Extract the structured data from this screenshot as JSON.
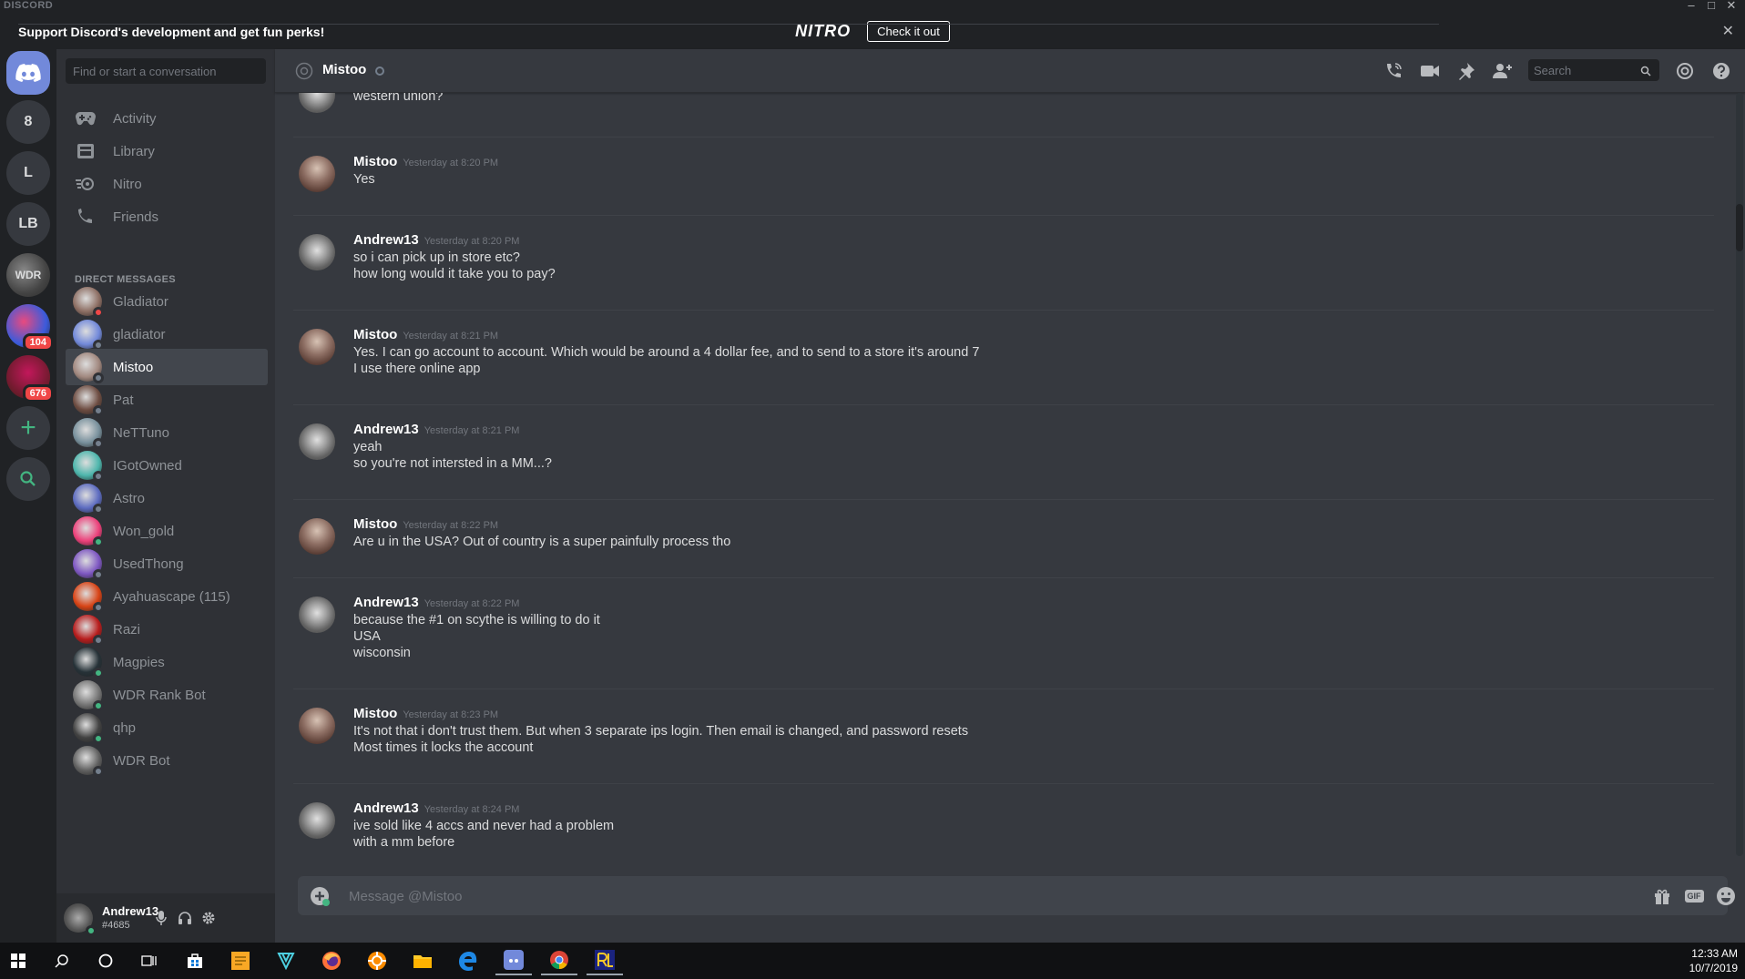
{
  "titlebar": {
    "brand": "DISCORD"
  },
  "banner": {
    "logo": "NITRO",
    "message": "Support Discord's development and get fun perks!",
    "cta": "Check it out"
  },
  "guilds": [
    {
      "label": "8"
    },
    {
      "label": "L"
    },
    {
      "label": "LB"
    },
    {
      "label": "WDR"
    },
    {
      "label": "",
      "badge": "104"
    },
    {
      "label": "",
      "badge": "676"
    }
  ],
  "sidebar": {
    "search_placeholder": "Find or start a conversation",
    "nav": [
      {
        "label": "Activity",
        "icon": "gamepad-icon"
      },
      {
        "label": "Library",
        "icon": "library-icon"
      },
      {
        "label": "Nitro",
        "icon": "nitro-icon"
      },
      {
        "label": "Friends",
        "icon": "friends-icon"
      }
    ],
    "dm_header": "DIRECT MESSAGES",
    "dms": [
      {
        "name": "Gladiator",
        "status": "dnd",
        "color": "#8d6e63"
      },
      {
        "name": "gladiator",
        "status": "offline",
        "color": "#7289da"
      },
      {
        "name": "Mistoo",
        "status": "offline",
        "color": "#a1887f",
        "active": true
      },
      {
        "name": "Pat",
        "status": "offline",
        "color": "#6d4c41"
      },
      {
        "name": "NeTTuno",
        "status": "offline",
        "color": "#78909c"
      },
      {
        "name": "IGotOwned",
        "status": "offline",
        "color": "#4db6ac"
      },
      {
        "name": "Astro",
        "status": "offline",
        "color": "#5c6bc0"
      },
      {
        "name": "Won_gold",
        "status": "online",
        "color": "#ec407a"
      },
      {
        "name": "UsedThong",
        "status": "offline",
        "color": "#7e57c2"
      },
      {
        "name": "Ayahuascape (115)",
        "status": "offline",
        "color": "#d84315"
      },
      {
        "name": "Razi",
        "status": "offline",
        "color": "#b71c1c"
      },
      {
        "name": "Magpies",
        "status": "online",
        "color": "#263238"
      },
      {
        "name": "WDR Rank Bot",
        "status": "online",
        "color": "#757575"
      },
      {
        "name": "qhp",
        "status": "online",
        "color": "#424242"
      },
      {
        "name": "WDR Bot",
        "status": "offline",
        "color": "#616161"
      }
    ]
  },
  "user": {
    "name": "Andrew13",
    "tag": "#4685"
  },
  "header": {
    "channel": "Mistoo",
    "search_placeholder": "Search"
  },
  "messages": [
    {
      "author": "",
      "time": "",
      "lines": [
        "western union?"
      ],
      "kind": "andrew"
    },
    {
      "author": "Mistoo",
      "time": "Yesterday at 8:20 PM",
      "lines": [
        "Yes"
      ],
      "kind": "mistoo"
    },
    {
      "author": "Andrew13",
      "time": "Yesterday at 8:20 PM",
      "lines": [
        "so i can pick up in store etc?",
        "how long would it take you to pay?"
      ],
      "kind": "andrew"
    },
    {
      "author": "Mistoo",
      "time": "Yesterday at 8:21 PM",
      "lines": [
        "Yes. I can go account to account. Which would be around a 4 dollar fee, and to send to a store it's around 7",
        "I use there online app"
      ],
      "kind": "mistoo"
    },
    {
      "author": "Andrew13",
      "time": "Yesterday at 8:21 PM",
      "lines": [
        "yeah",
        "so you're not intersted in a MM...?"
      ],
      "kind": "andrew"
    },
    {
      "author": "Mistoo",
      "time": "Yesterday at 8:22 PM",
      "lines": [
        "Are u in the USA? Out of country is a super painfully process tho"
      ],
      "kind": "mistoo"
    },
    {
      "author": "Andrew13",
      "time": "Yesterday at 8:22 PM",
      "lines": [
        "because the #1 on scythe is willing to do it",
        "USA",
        "wisconsin"
      ],
      "kind": "andrew"
    },
    {
      "author": "Mistoo",
      "time": "Yesterday at 8:23 PM",
      "lines": [
        "It's not that i don't trust them. But when 3 separate ips login. Then email is changed, and password resets",
        "Most times it locks the account"
      ],
      "kind": "mistoo"
    },
    {
      "author": "Andrew13",
      "time": "Yesterday at 8:24 PM",
      "lines": [
        "ive sold like 4 accs and never had a problem",
        "with a mm before"
      ],
      "kind": "andrew"
    }
  ],
  "composer": {
    "placeholder": "Message @Mistoo",
    "gif": "GIF"
  },
  "taskbar": {
    "time": "12:33 AM",
    "date": "10/7/2019"
  }
}
